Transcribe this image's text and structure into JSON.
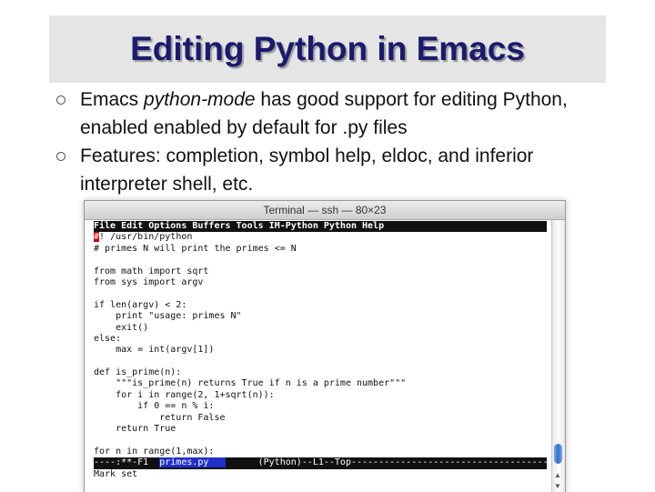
{
  "slide": {
    "title": "Editing Python in Emacs",
    "bullets": [
      {
        "pre": "Emacs ",
        "em": "python-mode",
        "post": " has good support for editing Python, enabled enabled by default for .py files"
      },
      {
        "text": "Features: completion, symbol help, eldoc, and inferior interpreter shell, etc."
      }
    ]
  },
  "terminal": {
    "window_title": "Terminal — ssh — 80×23",
    "menubar": "File Edit Options Buffers Tools IM-Python Python Help",
    "cursor_char": "#",
    "first_line_rest": "! /usr/bin/python",
    "code_lines": [
      "# primes N will print the primes <= N",
      "",
      "from math import sqrt",
      "from sys import argv",
      "",
      "if len(argv) < 2:",
      "    print \"usage: primes N\"",
      "    exit()",
      "else:",
      "    max = int(argv[1])",
      "",
      "def is_prime(n):",
      "    \"\"\"is_prime(n) returns True if n is a prime number\"\"\"",
      "    for i in range(2, 1+sqrt(n)):",
      "        if 0 == n % i:",
      "            return False",
      "    return True",
      "",
      "for n in range(1,max):"
    ],
    "modeline_left": "----:**-F1  ",
    "modeline_buffer": "primes.py   ",
    "modeline_right": "      (Python)--L1--Top-----------------------------------------",
    "minibuffer": "Mark set"
  },
  "colors": {
    "title": "#1a1a6e",
    "cursor": "#cc0000",
    "buffer_highlight": "#2030c8"
  }
}
